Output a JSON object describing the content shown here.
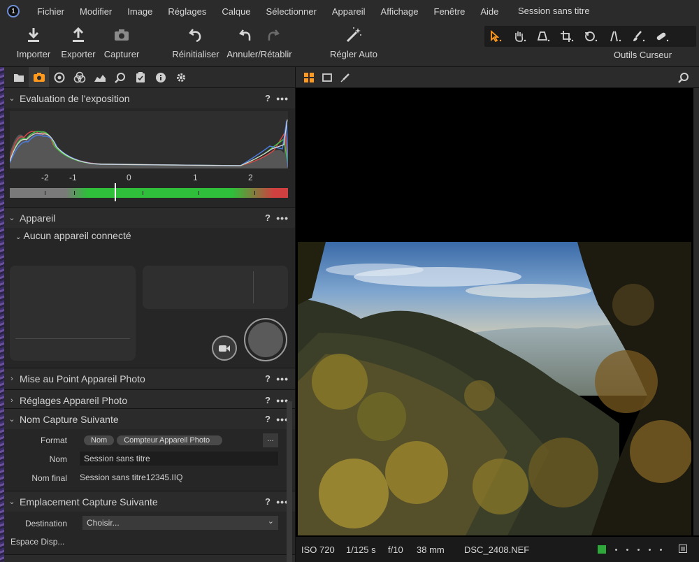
{
  "menu": {
    "items": [
      "Fichier",
      "Modifier",
      "Image",
      "Réglages",
      "Calque",
      "Sélectionner",
      "Appareil",
      "Affichage",
      "Fenêtre",
      "Aide"
    ],
    "window_title": "Session sans titre"
  },
  "toolbar": {
    "import_label": "Importer",
    "export_label": "Exporter",
    "capture_label": "Capturer",
    "reset_label": "Réinitialiser",
    "undo_redo_label": "Annuler/Rétablir",
    "auto_label": "Régler Auto",
    "cursor_tools_label": "Outils Curseur",
    "cursor_tool_icons": [
      "select-arrow-icon",
      "hand-pan-icon",
      "keystone-icon",
      "crop-icon",
      "rotate-icon",
      "straighten-icon",
      "brush-icon",
      "heal-icon"
    ]
  },
  "tool_tabs": [
    "library-icon",
    "capture-camera-icon",
    "lens-icon",
    "color-icon",
    "exposure-icon",
    "details-icon",
    "adjustments-icon",
    "metadata-icon",
    "settings-icon"
  ],
  "exposure": {
    "title": "Evaluation de l'exposition",
    "help": "?",
    "more": "•••",
    "axis_labels": [
      "-2",
      "-1",
      "0",
      "1",
      "2"
    ],
    "marker_value": 0
  },
  "camera": {
    "title": "Appareil",
    "help": "?",
    "more": "•••",
    "status": "Aucun appareil connecté"
  },
  "sections": {
    "focus_title": "Mise au Point Appareil Photo",
    "settings_title": "Réglages Appareil Photo",
    "next_name_title": "Nom Capture Suivante",
    "next_location_title": "Emplacement Capture Suivante",
    "help": "?",
    "more": "•••"
  },
  "next_name": {
    "format_label": "Format",
    "format_pills": [
      "Nom",
      "Compteur Appareil Photo"
    ],
    "format_button": "...",
    "name_label": "Nom",
    "name_value": "Session sans titre",
    "final_label": "Nom final",
    "final_value": "Session sans titre12345.IIQ"
  },
  "next_location": {
    "destination_label": "Destination",
    "destination_value": "Choisir...",
    "space_label": "Espace Disp..."
  },
  "viewer": {
    "tabs": [
      "grid-view-icon",
      "single-view-icon",
      "picker-icon"
    ],
    "iso": "ISO 720",
    "shutter": "1/125 s",
    "aperture": "f/10",
    "focal": "38 mm",
    "filename": "DSC_2408.NEF",
    "color_tag": "#2ea83a"
  },
  "colors": {
    "accent": "#ff9a1f",
    "panel": "#262626",
    "header": "#2b2b2b"
  }
}
